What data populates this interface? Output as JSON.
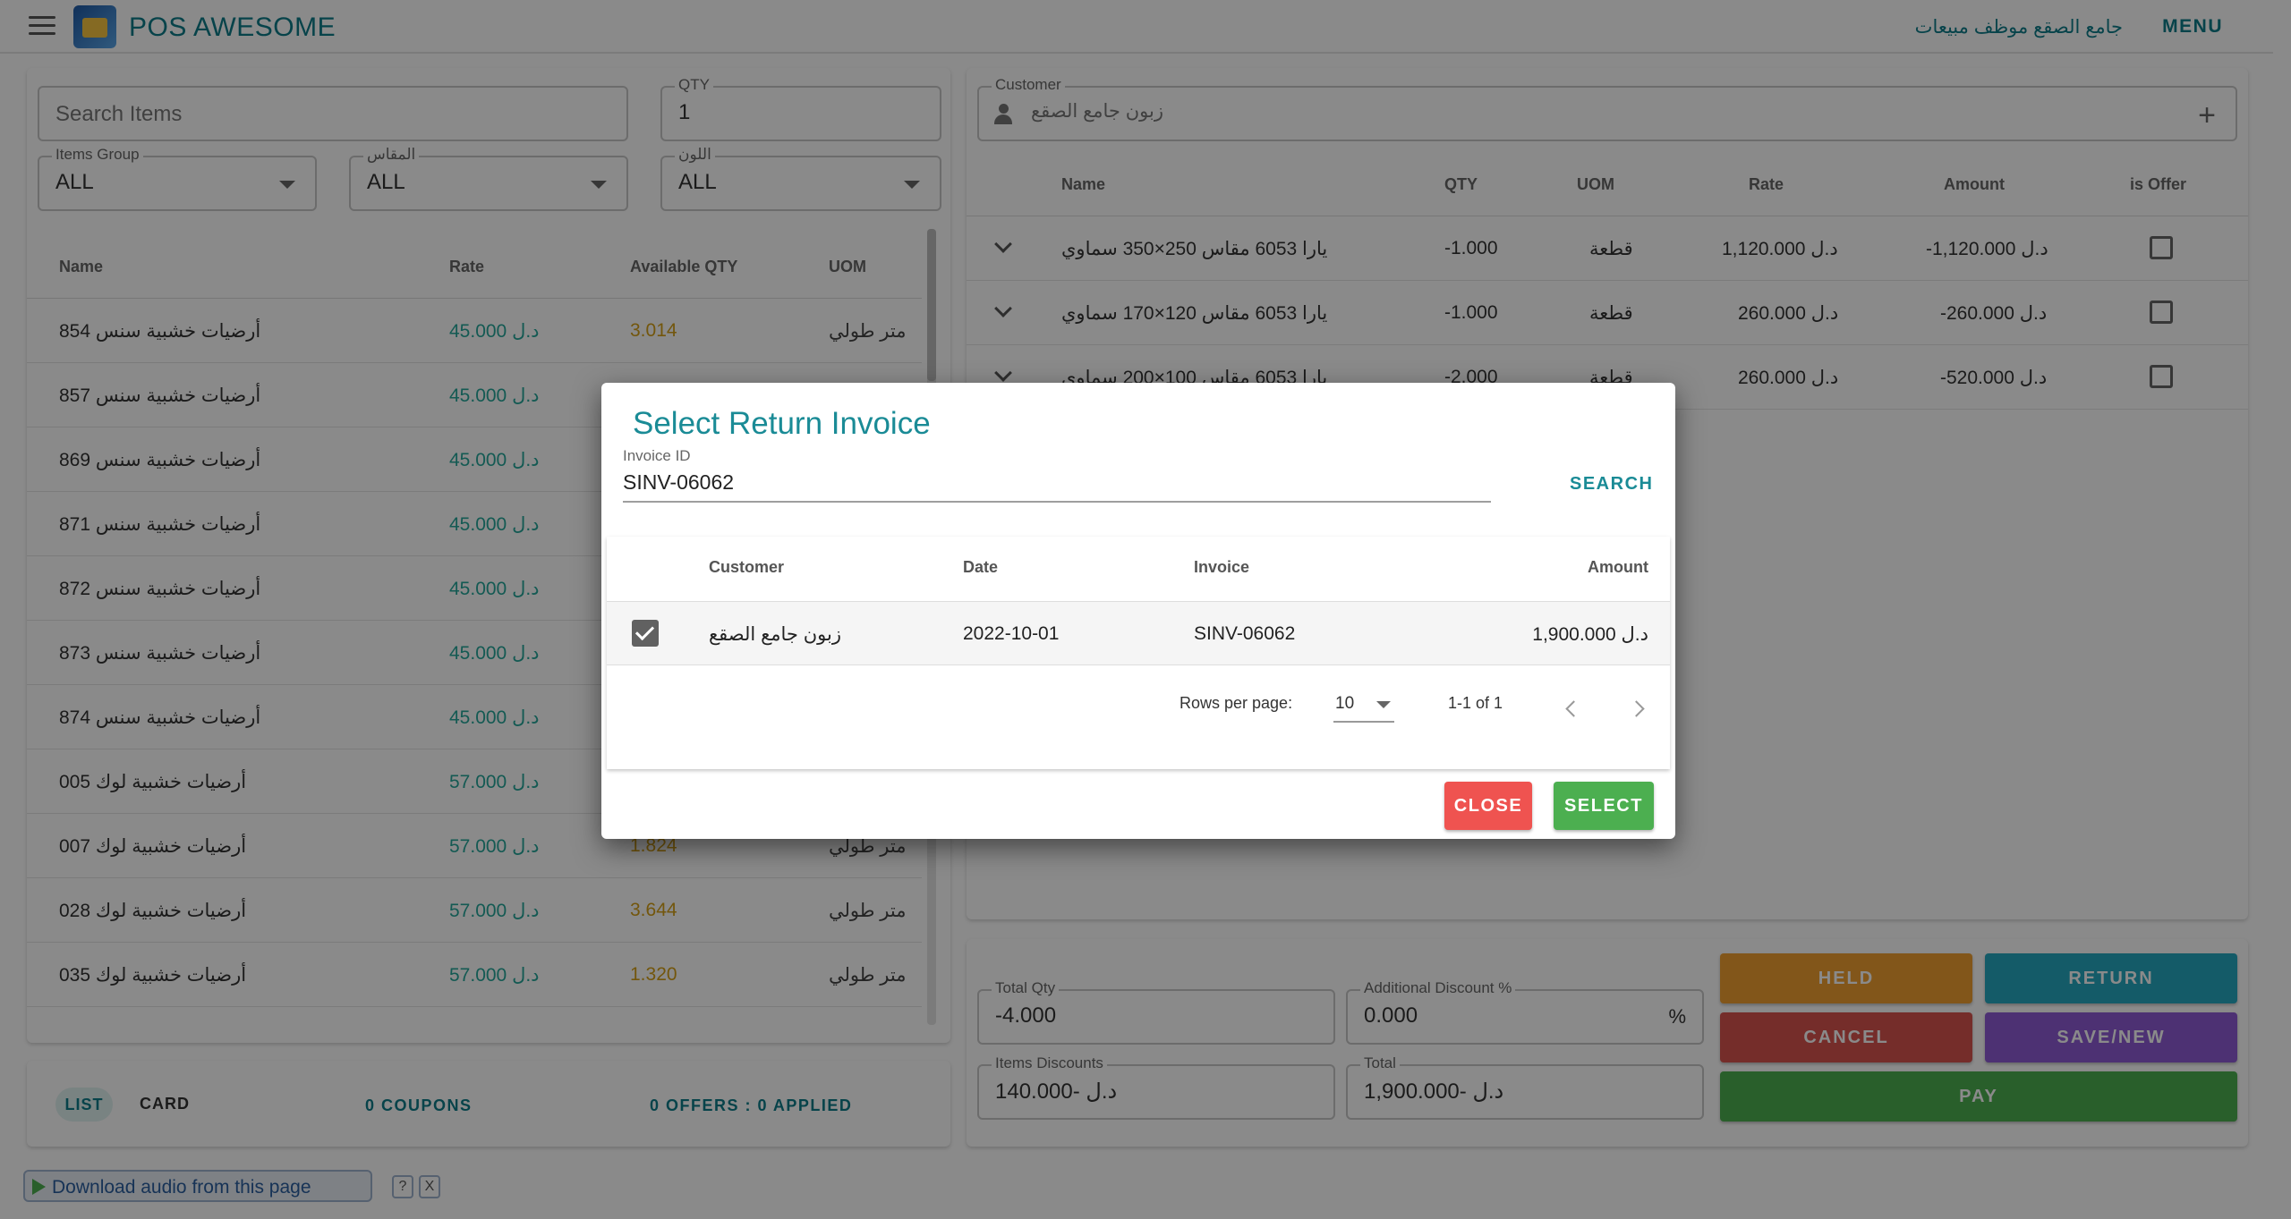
{
  "app": {
    "title": "POS AWESOME",
    "company": "جامع الصقع موظف مبيعات",
    "menu_label": "MENU"
  },
  "items_panel": {
    "search_placeholder": "Search Items",
    "qty_label": "QTY",
    "qty_value": "1",
    "filters": [
      {
        "label": "Items Group",
        "value": "ALL"
      },
      {
        "label": "المقاس",
        "value": "ALL"
      },
      {
        "label": "اللون",
        "value": "ALL"
      }
    ],
    "columns": [
      "Name",
      "Rate",
      "Available QTY",
      "UOM"
    ],
    "rows": [
      {
        "name": "أرضيات خشبية سنس 854",
        "rate": "45.000 د.ل",
        "qty": "3.014",
        "uom": "متر طولي"
      },
      {
        "name": "أرضيات خشبية سنس 857",
        "rate": "45.000 د.ل",
        "qty": "",
        "uom": ""
      },
      {
        "name": "أرضيات خشبية سنس 869",
        "rate": "45.000 د.ل",
        "qty": "",
        "uom": ""
      },
      {
        "name": "أرضيات خشبية سنس 871",
        "rate": "45.000 د.ل",
        "qty": "",
        "uom": ""
      },
      {
        "name": "أرضيات خشبية سنس 872",
        "rate": "45.000 د.ل",
        "qty": "",
        "uom": ""
      },
      {
        "name": "أرضيات خشبية سنس 873",
        "rate": "45.000 د.ل",
        "qty": "",
        "uom": ""
      },
      {
        "name": "أرضيات خشبية سنس 874",
        "rate": "45.000 د.ل",
        "qty": "",
        "uom": ""
      },
      {
        "name": "أرضيات خشبية لوك 005",
        "rate": "57.000 د.ل",
        "qty": "",
        "uom": ""
      },
      {
        "name": "أرضيات خشبية لوك 007",
        "rate": "57.000 د.ل",
        "qty": "1.824",
        "uom": "متر طولي"
      },
      {
        "name": "أرضيات خشبية لوك 028",
        "rate": "57.000 د.ل",
        "qty": "3.644",
        "uom": "متر طولي"
      },
      {
        "name": "أرضيات خشبية لوك 035",
        "rate": "57.000 د.ل",
        "qty": "1.320",
        "uom": "متر طولي"
      }
    ],
    "footer": {
      "tab_list": "LIST",
      "tab_card": "CARD",
      "coupons": "0 COUPONS",
      "offers": "0 OFFERS : 0 APPLIED"
    }
  },
  "cart": {
    "customer_label": "Customer",
    "customer_value": "زبون جامع الصقع",
    "columns": [
      "Name",
      "QTY",
      "UOM",
      "Rate",
      "Amount",
      "is Offer"
    ],
    "rows": [
      {
        "name": "يارا 6053 مقاس 250×350 سماوي",
        "qty": "-1.000",
        "uom": "قطعة",
        "rate": "1,120.000 د.ل",
        "amount": "-1,120.000 د.ل"
      },
      {
        "name": "يارا 6053 مقاس 120×170 سماوي",
        "qty": "-1.000",
        "uom": "قطعة",
        "rate": "260.000 د.ل",
        "amount": "-260.000 د.ل"
      },
      {
        "name": "يارا 6053 مقاس 100×200 سماوي",
        "qty": "-2.000",
        "uom": "قطعة",
        "rate": "260.000 د.ل",
        "amount": "-520.000 د.ل"
      }
    ]
  },
  "summary": {
    "total_qty_label": "Total Qty",
    "total_qty_value": "-4.000",
    "additional_discount_label": "Additional Discount %",
    "additional_discount_value": "0.000",
    "percent_symbol": "%",
    "items_discounts_label": "Items Discounts",
    "items_discounts_value": "د.ل -140.000",
    "total_label": "Total",
    "total_value": "د.ل -1,900.000",
    "buttons": {
      "held": "HELD",
      "return": "RETURN",
      "cancel": "CANCEL",
      "save_new": "SAVE/NEW",
      "pay": "PAY"
    }
  },
  "dialog": {
    "title": "Select Return Invoice",
    "invoice_id_label": "Invoice ID",
    "invoice_id_value": "SINV-06062",
    "search_label": "SEARCH",
    "columns": [
      "Customer",
      "Date",
      "Invoice",
      "Amount"
    ],
    "rows": [
      {
        "selected": true,
        "customer": "زبون جامع الصقع",
        "date": "2022-10-01",
        "invoice": "SINV-06062",
        "amount": "1,900.000 د.ل"
      }
    ],
    "rows_per_page_label": "Rows per page:",
    "rows_per_page_value": "10",
    "range_text": "1-1 of 1",
    "close_label": "CLOSE",
    "select_label": "SELECT"
  },
  "download_bar": {
    "text": "Download audio from this page",
    "help": "?",
    "close": "X"
  },
  "colors": {
    "accent": "#0d7d8a",
    "held": "#f0a030",
    "return": "#26a8c1",
    "cancel": "#d9534f",
    "save_new": "#8e5bd4",
    "pay": "#4caf50",
    "close": "#ef5350",
    "select": "#4caf50"
  }
}
